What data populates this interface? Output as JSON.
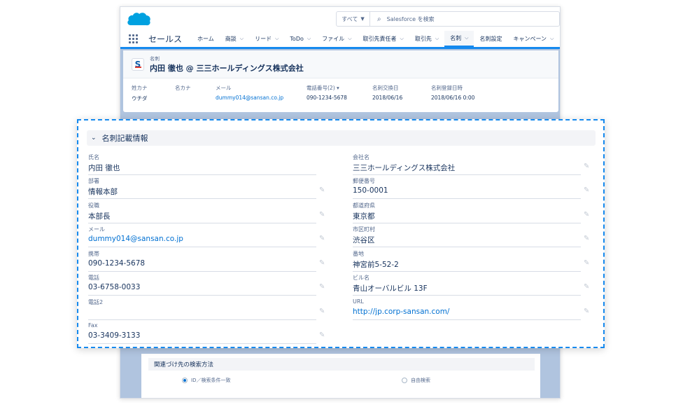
{
  "header": {
    "search_scope": "すべて",
    "search_placeholder": "Salesforce を検索"
  },
  "nav": {
    "app_name": "セールス",
    "items": [
      "ホーム",
      "商談",
      "リード",
      "ToDo",
      "ファイル",
      "取引先責任者",
      "取引先",
      "名刺",
      "名刺設定",
      "キャンペーン"
    ],
    "active": "名刺"
  },
  "record": {
    "type": "名刺",
    "name": "内田 徹也 @ 三三ホールディングス株式会社",
    "fields": [
      {
        "label": "姓カナ",
        "value": "ウチダ"
      },
      {
        "label": "名カナ",
        "value": ""
      },
      {
        "label": "メール",
        "value": "dummy014@sansan.co.jp",
        "link": true
      },
      {
        "label": "電話番号(2) ▾",
        "value": "090-1234-5678"
      },
      {
        "label": "名刺交換日",
        "value": "2018/06/16"
      },
      {
        "label": "名刺登録日時",
        "value": "2018/06/16 0:00"
      }
    ]
  },
  "detail": {
    "section_title": "名刺記載情報",
    "left": [
      {
        "label": "氏名",
        "value": "内田 徹也",
        "editable": false
      },
      {
        "label": "部署",
        "value": "情報本部",
        "editable": true
      },
      {
        "label": "役職",
        "value": "本部長",
        "editable": true
      },
      {
        "label": "メール",
        "value": "dummy014@sansan.co.jp",
        "editable": true,
        "link": true
      },
      {
        "label": "携帯",
        "value": "090-1234-5678",
        "editable": true
      },
      {
        "label": "電話",
        "value": "03-6758-0033",
        "editable": true
      },
      {
        "label": "電話2",
        "value": "",
        "editable": true
      },
      {
        "label": "Fax",
        "value": "03-3409-3133",
        "editable": true
      }
    ],
    "right": [
      {
        "label": "会社名",
        "value": "三三ホールディングス株式会社",
        "editable": true
      },
      {
        "label": "郵便番号",
        "value": "150-0001",
        "editable": true
      },
      {
        "label": "都道府県",
        "value": "東京都",
        "editable": true
      },
      {
        "label": "市区町村",
        "value": "渋谷区",
        "editable": true
      },
      {
        "label": "番地",
        "value": "神宮前5-52-2",
        "editable": true
      },
      {
        "label": "ビル名",
        "value": "青山オーバルビル 13F",
        "editable": true
      },
      {
        "label": "URL",
        "value": "http://jp.corp-sansan.com/",
        "editable": true,
        "link": true
      }
    ]
  },
  "related": {
    "title": "関連づけ先の検索方法",
    "option_id": "ID／検索条件一致",
    "option_free": "自由検索"
  },
  "colors": {
    "accent": "#1589ee",
    "link": "#0070d2",
    "text": "#16325c",
    "label": "#54698d"
  },
  "icons": [
    "salesforce-cloud-icon",
    "search-icon",
    "app-launcher-icon",
    "chevron-down-icon",
    "pencil-icon",
    "record-type-icon"
  ]
}
